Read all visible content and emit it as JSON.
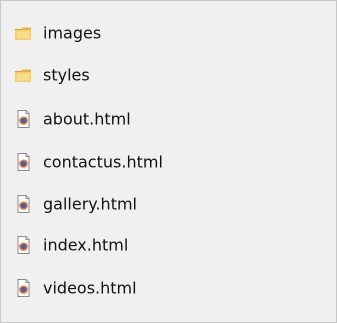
{
  "files": [
    {
      "name": "images",
      "icon": "folder-icon"
    },
    {
      "name": "styles",
      "icon": "folder-icon"
    },
    {
      "name": "about.html",
      "icon": "html-file-icon"
    },
    {
      "name": "contactus.html",
      "icon": "html-file-icon"
    },
    {
      "name": "gallery.html",
      "icon": "html-file-icon"
    },
    {
      "name": "index.html",
      "icon": "html-file-icon"
    },
    {
      "name": "videos.html",
      "icon": "html-file-icon"
    }
  ],
  "colors": {
    "background": "#f0f0f0",
    "text": "#111111",
    "folder": "#f2c64d",
    "file_page": "#ffffff",
    "browser_orange": "#ef6a22",
    "browser_blue": "#2c68c7"
  }
}
